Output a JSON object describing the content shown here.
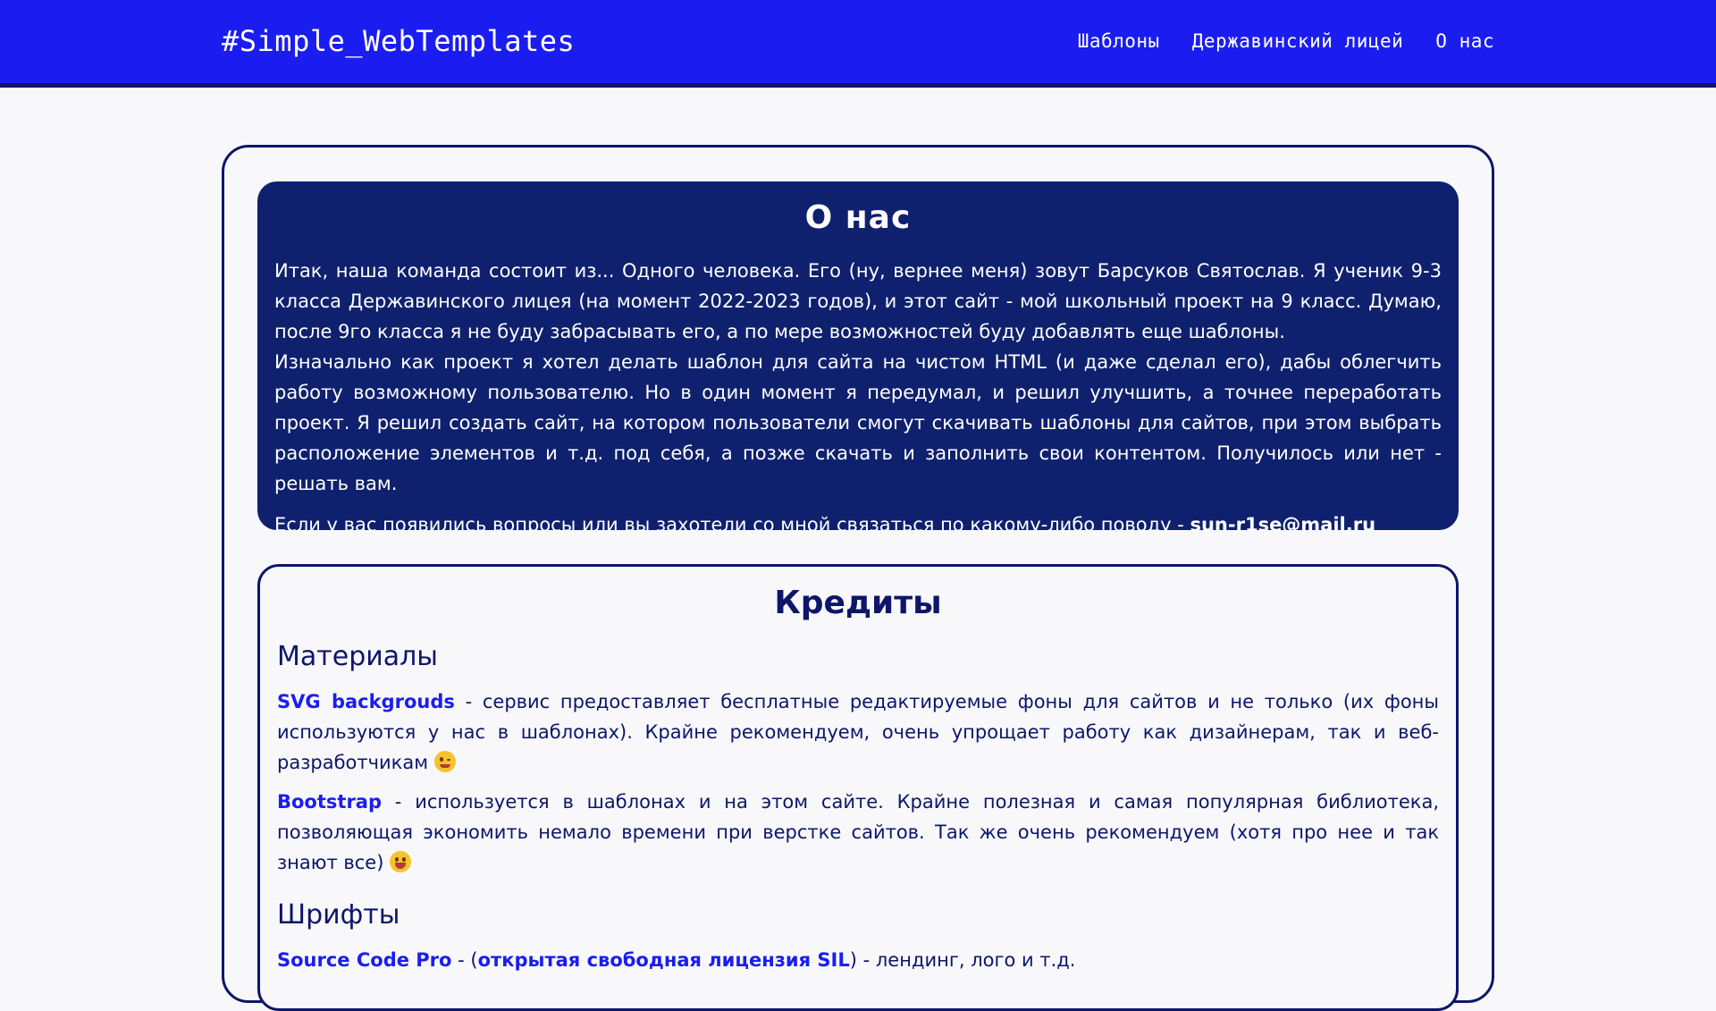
{
  "navbar": {
    "brand": "#Simple_WebTemplates",
    "links": [
      "Шаблоны",
      "Державинский лицей",
      "О нас"
    ],
    "bg_color": "#1b1df0"
  },
  "about": {
    "title": "О нас",
    "paragraph1": "Итак, наша команда состоит из... Одного человека. Его (ну, вернее меня) зовут Барсуков Святослав. Я ученик 9-3 класса Державинского лицея (на момент 2022-2023 годов), и этот сайт - мой школьный проект на 9 класс. Думаю, после 9го класса я не буду забрасывать его, а по мере возможностей буду добавлять еще шаблоны.",
    "paragraph2": "Изначально как проект я хотел делать шаблон для сайта на чистом HTML (и даже сделал его), дабы облегчить работу возможному пользователю. Но в один момент я передумал, и решил улучшить, а точнее переработать проект. Я решил создать сайт, на котором пользователи смогут скачивать шаблоны для сайтов, при этом выбрать расположение элементов и т.д. под себя, а позже скачать и заполнить свои контентом. Получилось или нет - решать вам.",
    "contact_text": "Если у вас появились вопросы или вы захотели со мной связаться по какому-либо поводу - ",
    "email": "sun-r1se@mail.ru",
    "bg_color": "#0f216e"
  },
  "credits": {
    "title": "Кредиты",
    "materials_title": "Материалы",
    "svg_link": "SVG backgrouds",
    "svg_text": " - сервис предоставляет бесплатные редактируемые фоны для сайтов и не только (их фоны используются у нас в шаблонах). Крайне рекомендуем, очень упрощает работу как дизайнерам, так и веб-разработчикам ",
    "svg_emoji": "winking-face-icon",
    "bootstrap_link": "Bootstrap",
    "bootstrap_text": " - используется в шаблонах и на этом сайте. Крайне полезная и самая популярная библиотека, позволяющая экономить немало времени при верстке сайтов. Так же очень рекомендуем (хотя про нее и так знают все) ",
    "bootstrap_emoji": "grinning-face-icon",
    "fonts_title": "Шрифты",
    "font_link": "Source Code Pro",
    "font_sep1": " - (",
    "font_license_link": "открытая свободная лицензия SIL",
    "font_sep2": ") - лендинг, лого и т.д.",
    "link_color": "#1b1df0"
  }
}
